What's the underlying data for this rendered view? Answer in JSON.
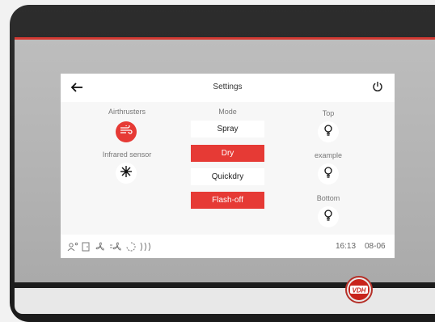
{
  "header": {
    "title": "Settings"
  },
  "left_column": {
    "airthrusters_label": "Airthrusters",
    "infrared_label": "Infrared sensor"
  },
  "mode": {
    "label": "Mode",
    "options": [
      {
        "label": "Spray",
        "active": false
      },
      {
        "label": "Dry",
        "active": true
      },
      {
        "label": "Quickdry",
        "active": false
      },
      {
        "label": "Flash-off",
        "active": true
      }
    ]
  },
  "lights": {
    "top_label": "Top",
    "middle_label": "example",
    "bottom_label": "Bottom"
  },
  "status": {
    "time": "16:13",
    "date": "08-06"
  },
  "colors": {
    "accent": "#e63a35",
    "bezel": "#b5b5b5",
    "frame": "#222222"
  },
  "icons": [
    "back-arrow-icon",
    "power-icon",
    "airthrusters-icon",
    "infrared-sensor-icon",
    "lightbulb-icon",
    "user-temperature-icon",
    "door-icon",
    "fan-icon",
    "fan-speed-icon",
    "spinner-icon",
    "signal-waves-icon",
    "vdh-logo"
  ],
  "brand": {
    "logo_text": "VDH"
  }
}
